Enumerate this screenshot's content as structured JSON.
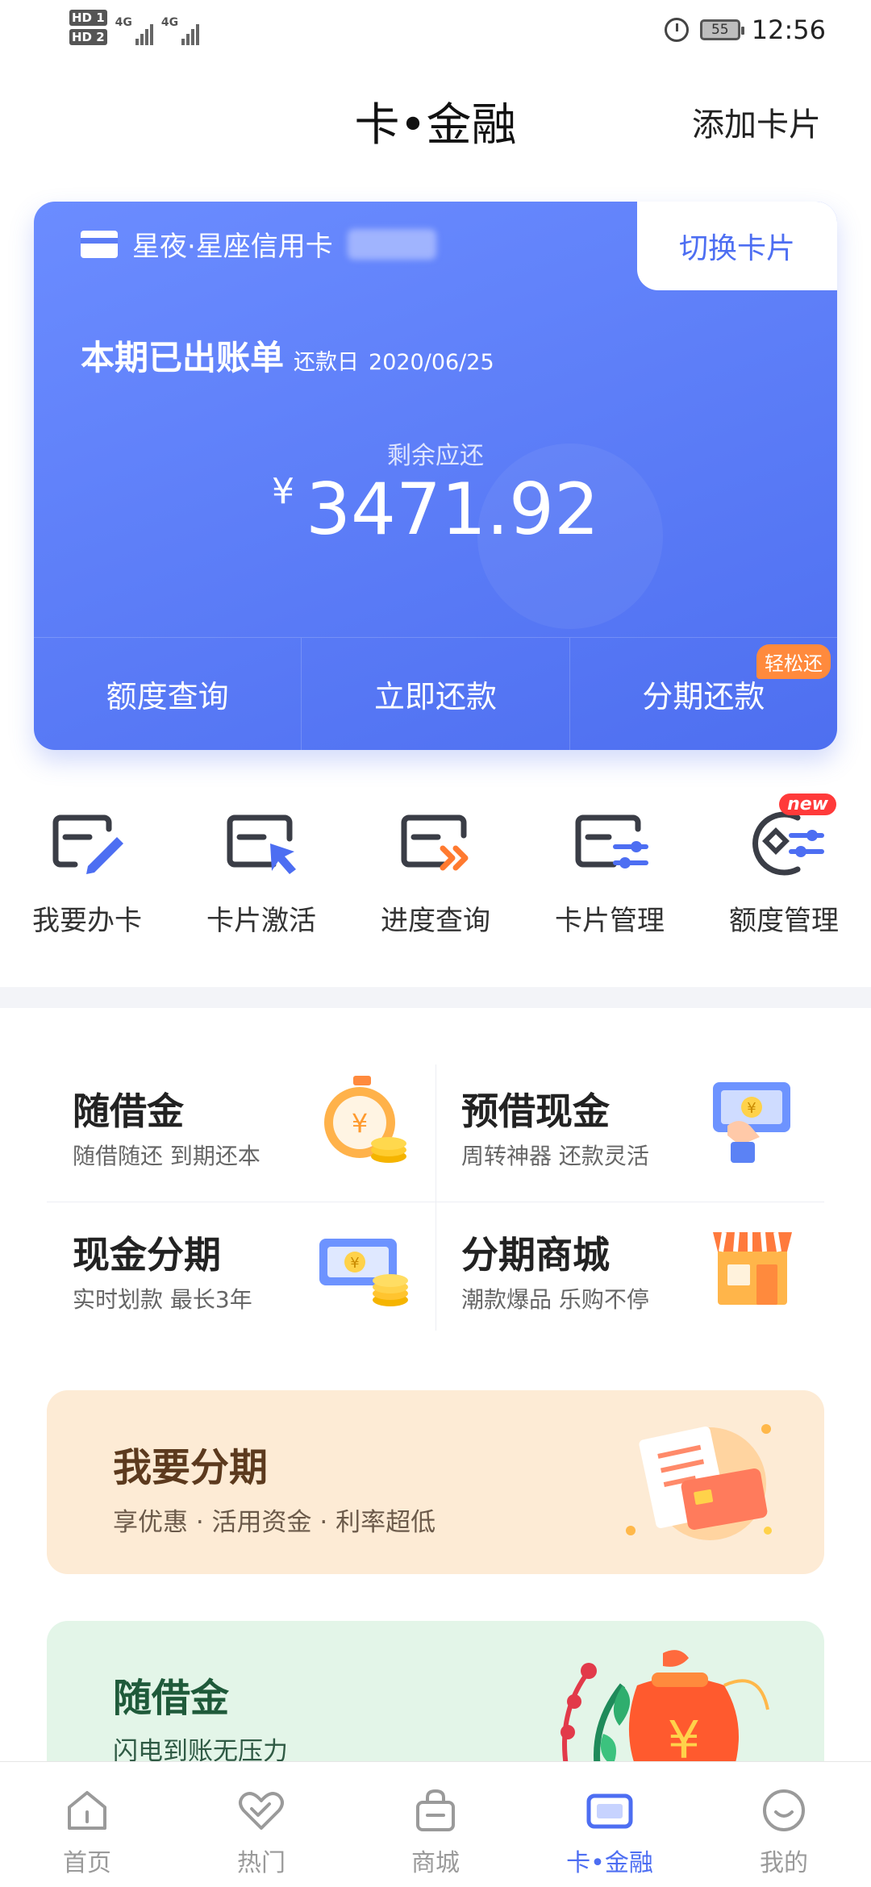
{
  "status_bar": {
    "sim1": "HD 1",
    "sim2": "HD 2",
    "network1": "4G",
    "network2": "4G",
    "battery": "55",
    "time": "12:56"
  },
  "header": {
    "title": "卡•金融",
    "add_card": "添加卡片"
  },
  "bill_card": {
    "card_name": "星夜·星座信用卡",
    "switch_card": "切换卡片",
    "bill_title": "本期已出账单",
    "due_label": "还款日",
    "due_date": "2020/06/25",
    "remaining_label": "剩余应还",
    "currency": "¥",
    "amount": "3471.92",
    "actions": [
      {
        "label": "额度查询"
      },
      {
        "label": "立即还款"
      },
      {
        "label": "分期还款",
        "badge": "轻松还"
      }
    ]
  },
  "services": [
    {
      "label": "我要办卡",
      "icon": "card-pen-icon"
    },
    {
      "label": "卡片激活",
      "icon": "card-cursor-icon"
    },
    {
      "label": "进度查询",
      "icon": "card-progress-icon"
    },
    {
      "label": "卡片管理",
      "icon": "card-manage-icon"
    },
    {
      "label": "额度管理",
      "icon": "limit-manage-icon",
      "tag": "new"
    }
  ],
  "finance": [
    {
      "name": "随借金",
      "desc": "随借随还 到期还本",
      "icon": "stopwatch-coin-icon"
    },
    {
      "name": "预借现金",
      "desc": "周转神器 还款灵活",
      "icon": "cash-hand-icon"
    },
    {
      "name": "现金分期",
      "desc": "实时划款 最长3年",
      "icon": "banknote-coins-icon"
    },
    {
      "name": "分期商城",
      "desc": "潮款爆品 乐购不停",
      "icon": "store-icon"
    }
  ],
  "promos": [
    {
      "title": "我要分期",
      "subtitle": "享优惠 · 活用资金 · 利率超低",
      "icon": "bill-card-icon"
    },
    {
      "title": "随借金",
      "subtitle": "闪电到账无压力",
      "icon": "money-bag-icon"
    }
  ],
  "bottom_nav": [
    {
      "label": "首页",
      "icon": "home-icon"
    },
    {
      "label": "热门",
      "icon": "heart-icon"
    },
    {
      "label": "商城",
      "icon": "shopping-bag-icon"
    },
    {
      "label": "卡•金融",
      "icon": "card-icon",
      "active": true
    },
    {
      "label": "我的",
      "icon": "profile-icon"
    }
  ],
  "colors": {
    "accent": "#4d6ef2",
    "card_gradient_start": "#6b8cff",
    "card_gradient_end": "#4e6ff0",
    "badge": "#ff8a3d",
    "promo_orange": "#fdebd5",
    "promo_green": "#e3f5e8"
  }
}
